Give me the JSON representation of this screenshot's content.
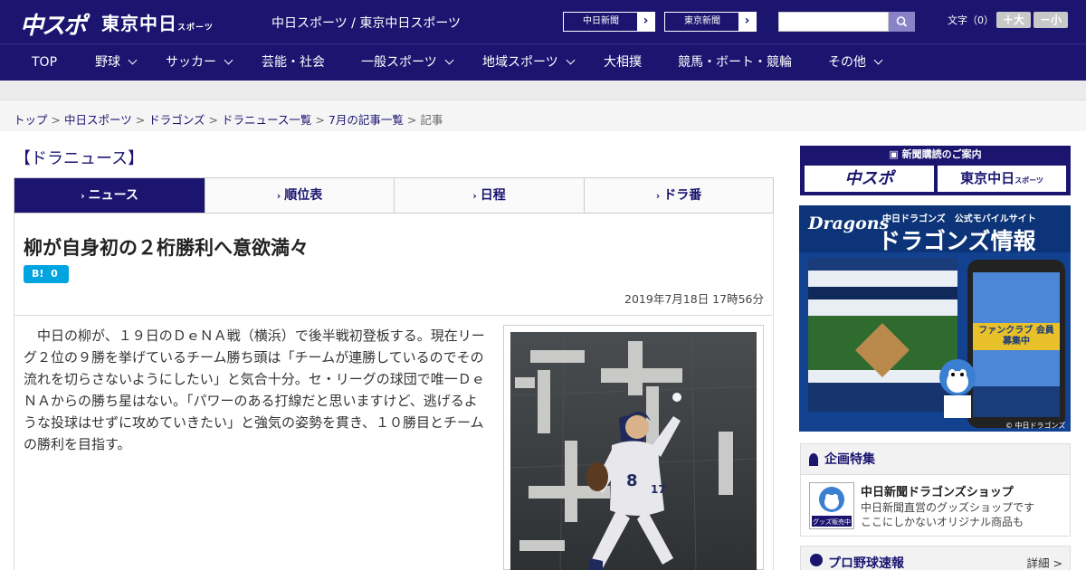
{
  "header": {
    "logo_main": "中スポ",
    "logo_tokyo": "東京中日",
    "logo_tokyo_sub": "スポーツ",
    "site_name": "中日スポーツ / 東京中日スポーツ",
    "paper_links": [
      "中日新聞",
      "東京新聞"
    ],
    "search_placeholder": "",
    "font_size_label": "文字（0）",
    "font_plus": "＋大",
    "font_minus": "－小"
  },
  "nav": {
    "items": [
      {
        "label": "TOP",
        "dropdown": false
      },
      {
        "label": "野球",
        "dropdown": true
      },
      {
        "label": "サッカー",
        "dropdown": true
      },
      {
        "label": "芸能・社会",
        "dropdown": false
      },
      {
        "label": "一般スポーツ",
        "dropdown": true
      },
      {
        "label": "地域スポーツ",
        "dropdown": true
      },
      {
        "label": "大相撲",
        "dropdown": false
      },
      {
        "label": "競馬・ボート・競輪",
        "dropdown": false
      },
      {
        "label": "その他",
        "dropdown": true
      }
    ]
  },
  "breadcrumb": {
    "links": [
      "トップ",
      "中日スポーツ",
      "ドラゴンズ",
      "ドラニュース一覧",
      "7月の記事一覧"
    ],
    "current": "記事",
    "separator": ">"
  },
  "article": {
    "category": "【ドラニュース】",
    "tabs": [
      {
        "label": "ニュース",
        "active": true
      },
      {
        "label": "順位表",
        "active": false
      },
      {
        "label": "日程",
        "active": false
      },
      {
        "label": "ドラ番",
        "active": false
      }
    ],
    "title": "柳が自身初の２桁勝利へ意欲満々",
    "hatena_label": "B!",
    "hatena_count": "0",
    "date": "2019年7月18日 17時56分",
    "body": "中日の柳が、１９日のＤｅＮＡ戦（横浜）で後半戦初登板する。現在リーグ２位の９勝を挙げているチーム勝ち頭は「チームが連勝しているのでその流れを切らさないようにしたい」と気合十分。セ・リーグの球団で唯一ＤｅＮＡからの勝ち星はない。「パワーのある打線だと思いますけど、逃げるような投球はせずに攻めていきたい」と強気の姿勢を貫き、１０勝目とチームの勝利を目指す。"
  },
  "sidebar": {
    "subscribe_head": "新聞購読のご案内",
    "subscribe_buttons": [
      "中スポ",
      "東京中日"
    ],
    "subscribe_sub": "スポーツ",
    "banner": {
      "brand": "Dragons",
      "line1": "中日ドラゴンズ　公式モバイルサイト",
      "line2": "ドラゴンズ情報",
      "badge": "ファンクラブ 会員募集中",
      "copyright": "© 中日ドラゴンズ"
    },
    "feature": {
      "heading": "企画特集",
      "shop_title": "中日新聞ドラゴンズショップ",
      "shop_desc1": "中日新聞直営のグッズショップです",
      "shop_desc2": "ここにしかないオリジナル商品も",
      "thumb_label": "グッズ販売中"
    },
    "score": {
      "heading": "プロ野球速報",
      "more": "詳細 >"
    }
  },
  "colors": {
    "brand_navy": "#1b1570",
    "hatena_blue": "#00a4de"
  }
}
